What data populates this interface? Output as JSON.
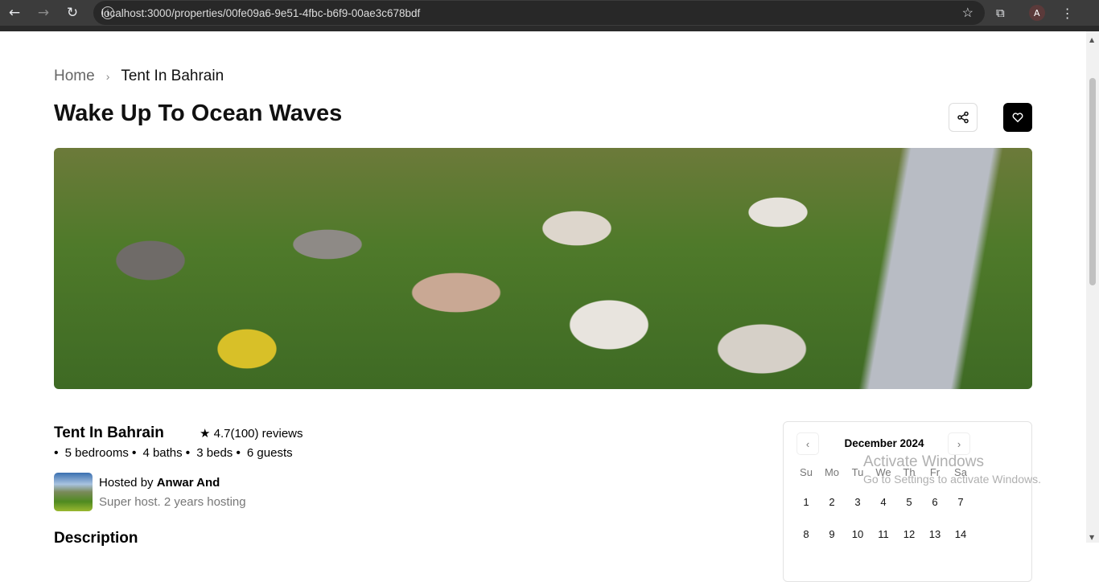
{
  "browser": {
    "url": "localhost:3000/properties/00fe09a6-9e51-4fbc-b6f9-00ae3c678bdf",
    "profile_initial": "A"
  },
  "breadcrumb": {
    "home": "Home",
    "current": "Tent In Bahrain"
  },
  "page_title": "Wake Up To Ocean Waves",
  "property": {
    "name": "Tent In Bahrain",
    "rating": "4.7(100) reviews",
    "features": [
      "5 bedrooms",
      "4 baths",
      "3 beds",
      "6 guests"
    ]
  },
  "host": {
    "prefix": "Hosted by ",
    "name": "Anwar And",
    "subtitle": "Super host. 2 years hosting"
  },
  "description_heading": "Description",
  "calendar": {
    "month": "December 2024",
    "weekdays": [
      "Su",
      "Mo",
      "Tu",
      "We",
      "Th",
      "Fr",
      "Sa"
    ],
    "days": [
      "1",
      "2",
      "3",
      "4",
      "5",
      "6",
      "7",
      "8",
      "9",
      "10",
      "11",
      "12",
      "13",
      "14"
    ]
  },
  "watermark": {
    "line1": "Activate Windows",
    "line2": "Go to Settings to activate Windows."
  }
}
